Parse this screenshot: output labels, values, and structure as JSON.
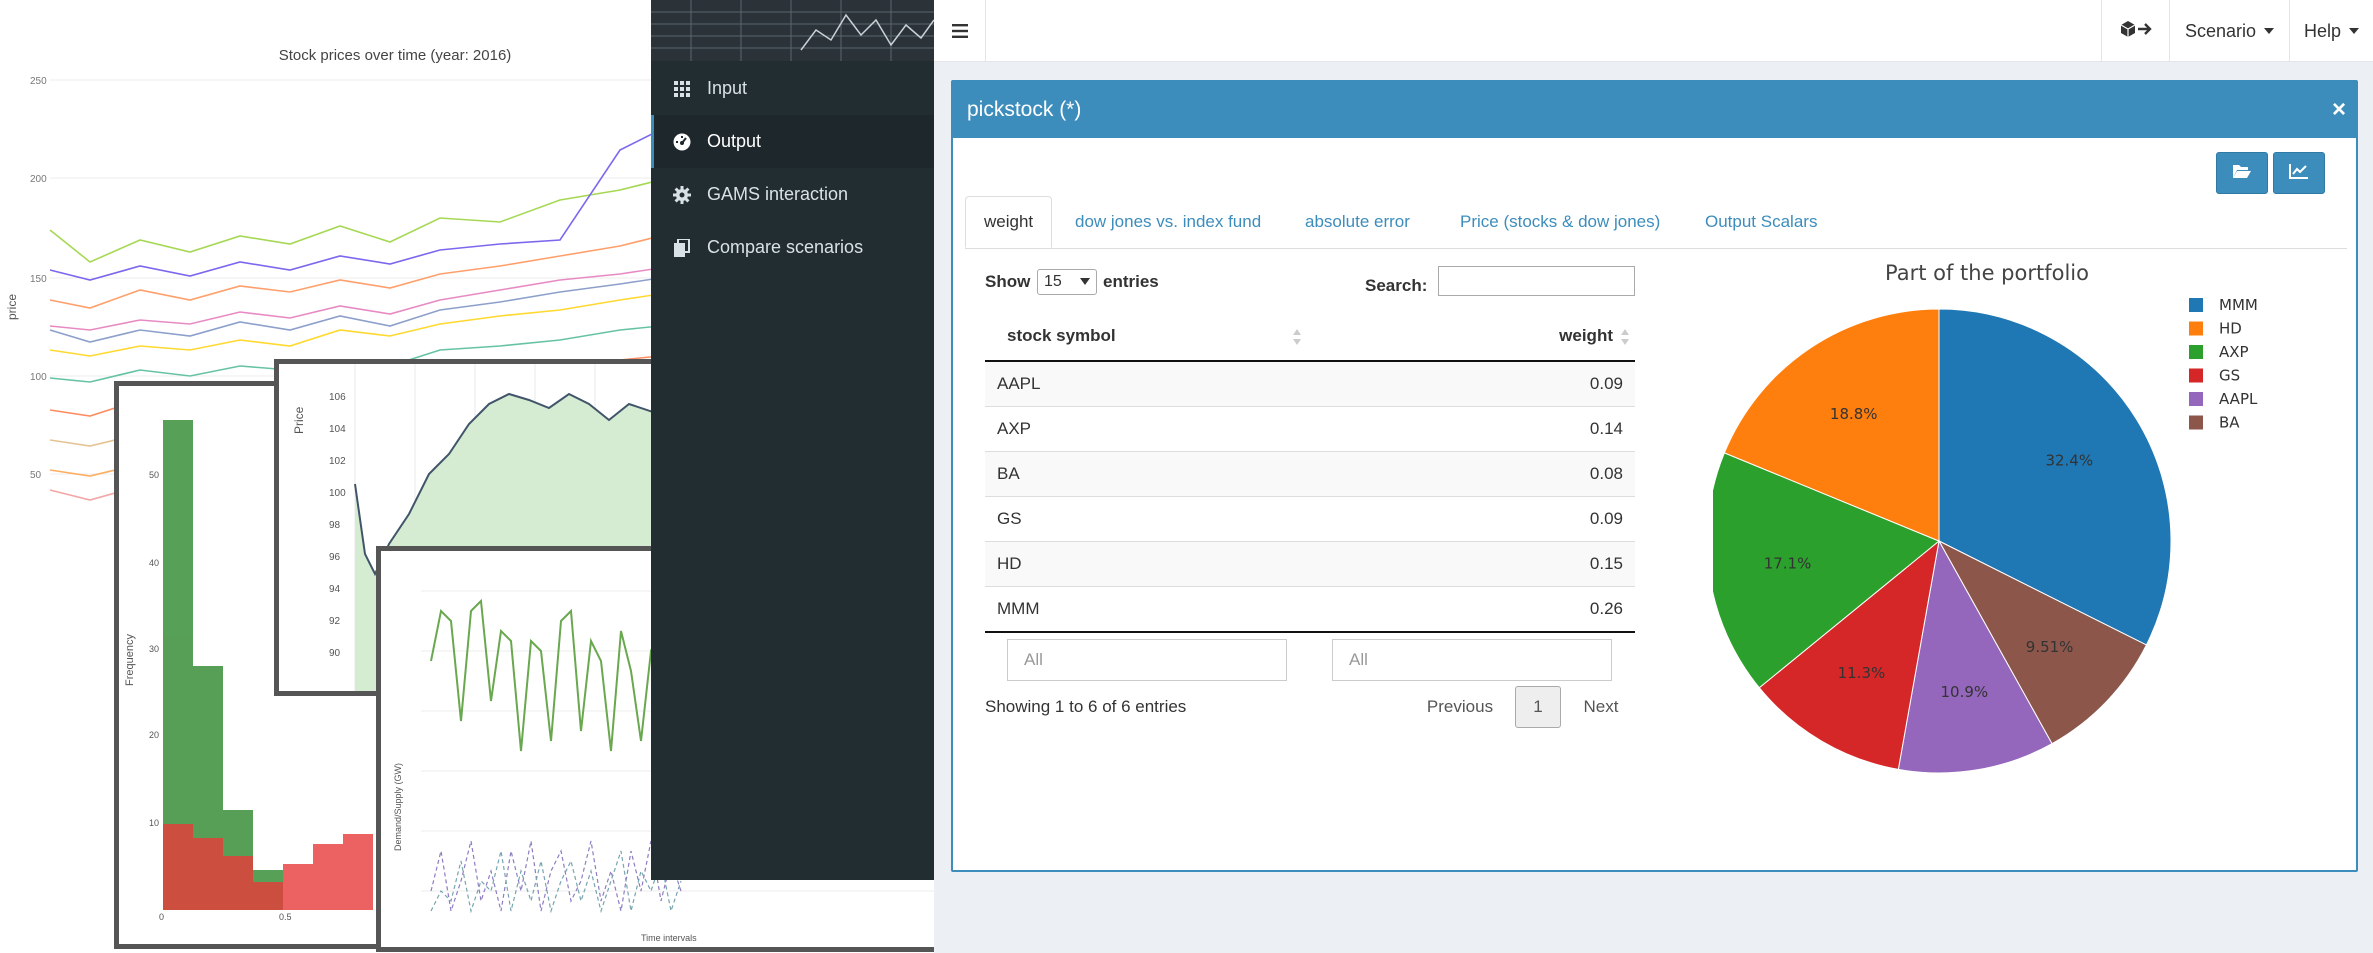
{
  "collage": {
    "chart1_title": "Stock prices over time (year: 2016)",
    "chart1_ylabel": "price",
    "chart1_yticks": [
      "250",
      "200",
      "150",
      "100",
      "50"
    ],
    "hist_ylabel": "Frequency",
    "hist_yticks": [
      "50",
      "40",
      "30",
      "20",
      "10"
    ],
    "hist_xticks": [
      "0",
      "0.5"
    ],
    "price_ylabel": "Price",
    "price_yticks": [
      "106",
      "104",
      "102",
      "100",
      "98",
      "96",
      "94",
      "92",
      "90"
    ],
    "demand_ylabel": "Demand/Supply (GW)",
    "demand_xlabel": "Time intervals"
  },
  "sidebar": {
    "items": [
      {
        "label": "Input",
        "icon": "grid-icon"
      },
      {
        "label": "Output",
        "icon": "dashboard-icon"
      },
      {
        "label": "GAMS interaction",
        "icon": "gear-icon"
      },
      {
        "label": "Compare scenarios",
        "icon": "copy-icon"
      }
    ],
    "active": "Output"
  },
  "header": {
    "menu_icon": "hamburger-icon",
    "import_icon": "cube-arrow-icon",
    "scenario_label": "Scenario",
    "help_label": "Help"
  },
  "modal": {
    "title": "pickstock (*)",
    "close_label": "×",
    "tools": [
      {
        "icon": "folder-open-icon"
      },
      {
        "icon": "line-chart-icon"
      }
    ],
    "tabs": [
      "weight",
      "dow jones vs. index fund",
      "absolute error",
      "Price (stocks & dow jones)",
      "Output Scalars"
    ],
    "active_tab": "weight"
  },
  "table": {
    "show_label": "Show",
    "page_length": "15",
    "entries_label": "entries",
    "search_label": "Search:",
    "search_value": "",
    "columns": [
      "stock symbol",
      "weight"
    ],
    "rows": [
      [
        "AAPL",
        "0.09"
      ],
      [
        "AXP",
        "0.14"
      ],
      [
        "BA",
        "0.08"
      ],
      [
        "GS",
        "0.09"
      ],
      [
        "HD",
        "0.15"
      ],
      [
        "MMM",
        "0.26"
      ]
    ],
    "filter_placeholders": [
      "All",
      "All"
    ],
    "info": "Showing 1 to 6 of 6 entries",
    "prev_label": "Previous",
    "page": "1",
    "next_label": "Next"
  },
  "chart_data": {
    "type": "pie",
    "title": "Part of the portfolio",
    "legend_position": "right",
    "categories": [
      "MMM",
      "HD",
      "AXP",
      "GS",
      "AAPL",
      "BA"
    ],
    "values": [
      32.4,
      18.8,
      17.1,
      11.3,
      10.9,
      9.51
    ],
    "labels": [
      "32.4%",
      "18.8%",
      "17.1%",
      "11.3%",
      "10.9%",
      "9.51%"
    ],
    "colors": [
      "#1f77b4",
      "#ff7f0e",
      "#2ca02c",
      "#d62728",
      "#9467bd",
      "#8c564b"
    ],
    "slice_order": [
      "MMM",
      "BA",
      "AAPL",
      "GS",
      "AXP",
      "HD"
    ],
    "direction": "clockwise"
  }
}
